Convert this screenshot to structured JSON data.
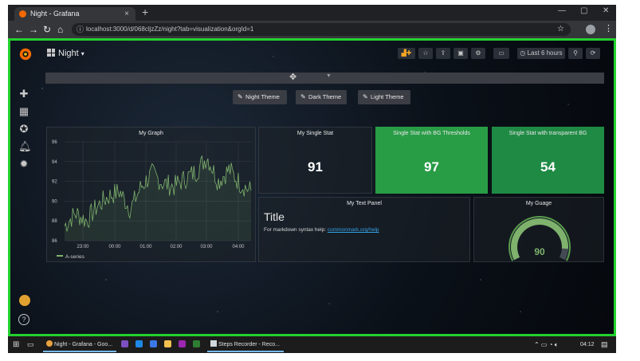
{
  "browser": {
    "tab_title": "Night - Grafana",
    "tab_close": "×",
    "new_tab": "+",
    "url": "localhost:3000/d/068cljzZz/night?tab=visualization&orgId=1",
    "window_controls": [
      "—",
      "▢",
      "✕"
    ]
  },
  "grafana": {
    "dashboard_title": "Night",
    "dashboard_caret": "▾",
    "time_picker": "Last 6 hours",
    "theme_buttons": [
      "Night Theme",
      "Dark Theme",
      "Light Theme"
    ],
    "panels": {
      "graph": {
        "title": "My Graph",
        "legend": "A-series",
        "y_ticks": [
          "96",
          "94",
          "92",
          "90",
          "88",
          "86"
        ],
        "x_ticks": [
          "23:00",
          "00:00",
          "01:00",
          "02:00",
          "03:00",
          "04:00"
        ]
      },
      "single_stat": {
        "title": "My Single Stat",
        "value": "91"
      },
      "bg_thresholds": {
        "title": "Single Stat with BG Thresholds",
        "value": "97"
      },
      "transparent_bg": {
        "title": "Single Stat with transparent BG",
        "value": "54"
      },
      "text": {
        "title": "My Text Panel",
        "heading": "Title",
        "body_prefix": "For markdown syntax help: ",
        "link": "commonmark.org/help"
      },
      "gauge": {
        "title": "My Guage",
        "value": "90",
        "value_fraction": 0.9
      }
    },
    "colors": {
      "green_panel": "#299c46",
      "teal_panel": "#1f8a44",
      "series": "#7eb26d",
      "link": "#33a2e5",
      "frame_highlight": "#23d12e"
    }
  },
  "chart_data": {
    "type": "line",
    "title": "My Graph",
    "x": [
      "22:40",
      "23:00",
      "23:20",
      "23:40",
      "00:00",
      "00:20",
      "00:40",
      "01:00",
      "01:20",
      "01:40",
      "02:00",
      "02:20",
      "02:40",
      "03:00",
      "03:20",
      "03:40",
      "04:00",
      "04:10"
    ],
    "series": [
      {
        "name": "A-series",
        "values": [
          87.5,
          88.8,
          88.0,
          89.5,
          90.5,
          91.0,
          89.2,
          91.5,
          92.8,
          91.8,
          91.5,
          92.3,
          93.0,
          94.5,
          92.0,
          93.2,
          91.8,
          91.0
        ]
      }
    ],
    "ylim": [
      86,
      96
    ],
    "grid": true,
    "legend_position": "bottom-left"
  },
  "taskbar": {
    "apps": [
      "Night - Grafana - Goo...",
      "Steps Recorder - Reco..."
    ],
    "clock": "04:12"
  }
}
